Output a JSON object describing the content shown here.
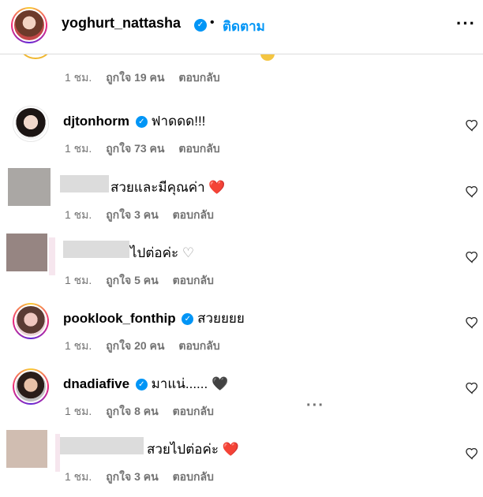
{
  "header": {
    "username": "yoghurt_nattasha",
    "separator": "•",
    "follow_label": "ติดตาม",
    "more_label": "···"
  },
  "meta": {
    "time": "1 ชม.",
    "reply": "ตอบกลับ"
  },
  "comments": [
    {
      "time": "1 ชม.",
      "likes": "ถูกใจ 19 คน",
      "reply": "ตอบกลับ"
    },
    {
      "username": "djtonhorm",
      "text": "ฟาดดด!!!",
      "time": "1 ชม.",
      "likes": "ถูกใจ 73 คน",
      "reply": "ตอบกลับ"
    },
    {
      "text": "สวยและมีคุณค่า",
      "emoji": "❤️",
      "time": "1 ชม.",
      "likes": "ถูกใจ 3 คน",
      "reply": "ตอบกลับ"
    },
    {
      "text": "ไปต่อค่ะ",
      "emoji": "♡",
      "time": "1 ชม.",
      "likes": "ถูกใจ 5 คน",
      "reply": "ตอบกลับ"
    },
    {
      "username": "pooklook_fonthip",
      "text": "สวยยยย",
      "time": "1 ชม.",
      "likes": "ถูกใจ 20 คน",
      "reply": "ตอบกลับ"
    },
    {
      "username": "dnadiafive",
      "text": "มาแน่......",
      "emoji": "🖤",
      "time": "1 ชม.",
      "likes": "ถูกใจ 8 คน",
      "reply": "ตอบกลับ",
      "more": "···"
    },
    {
      "text": "สวยไปต่อค่ะ",
      "emoji": "❤️",
      "time": "1 ชม.",
      "likes": "ถูกใจ 3 คน",
      "reply": "ตอบกลับ"
    }
  ],
  "icons": {
    "like": "heart-outline-icon",
    "verified": "verified-badge-icon",
    "more": "more-horizontal-icon"
  },
  "colors": {
    "accent": "#0095f6",
    "muted": "#737373",
    "heart": "#e0245e"
  }
}
